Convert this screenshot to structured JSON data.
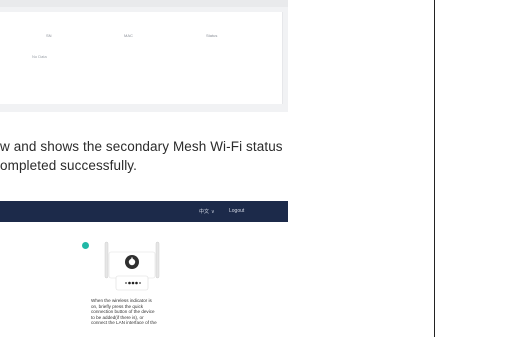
{
  "top_screenshot": {
    "table": {
      "columns": [
        "SN",
        "MAC",
        "Status"
      ],
      "empty_text": "No Data"
    }
  },
  "instructions": {
    "line1": "w and shows the secondary Mesh Wi-Fi status",
    "line2": "ompleted successfully."
  },
  "bottom_screenshot": {
    "nav": {
      "language": "中文",
      "language_chevron": "∨",
      "logout": "Logout"
    },
    "router_icon": "router-icon",
    "step_instruction": [
      "When the wireless indicator is",
      "on, briefly press the quick",
      "connection button of the device",
      "to be added(if there is), or",
      "connect the LAN interface of the"
    ]
  }
}
